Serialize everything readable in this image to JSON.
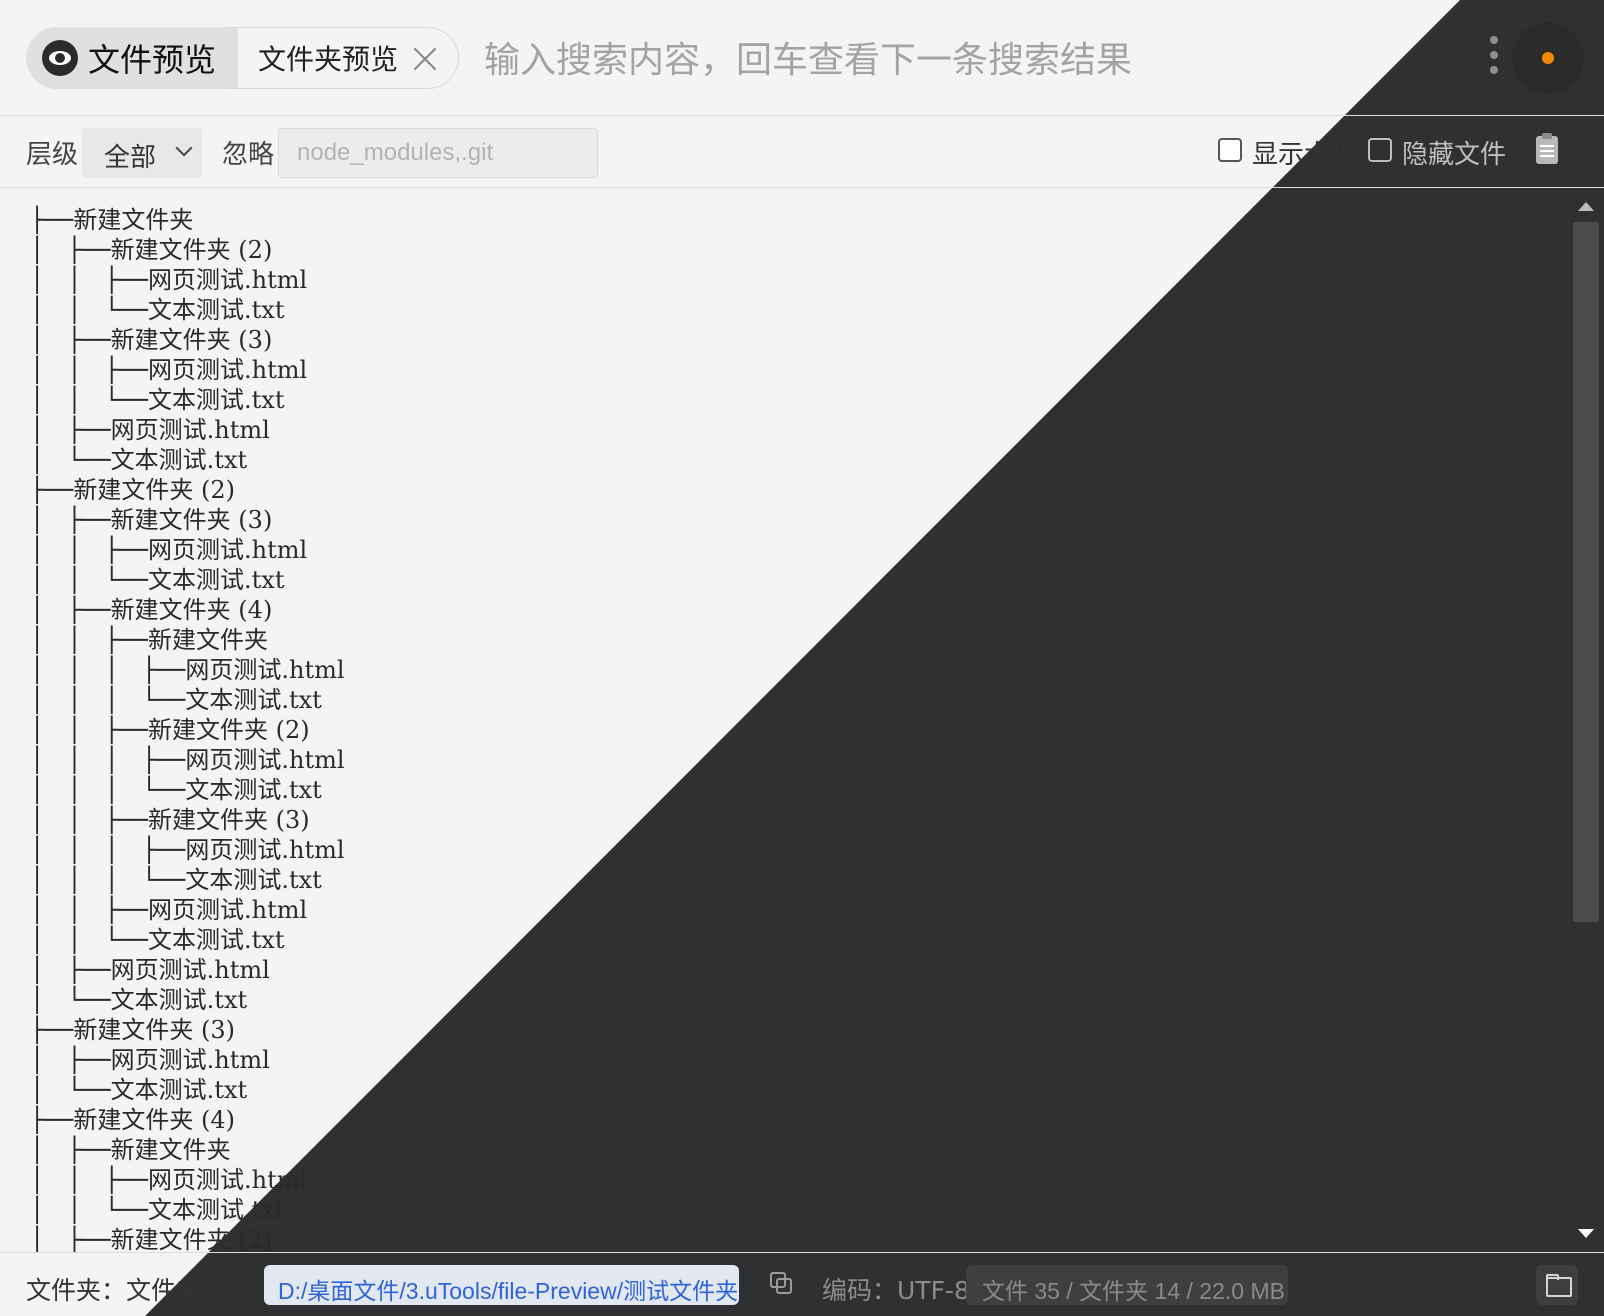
{
  "header": {
    "tabs": [
      {
        "label": "文件预览",
        "active": true,
        "icon": "eye-icon"
      },
      {
        "label": "文件夹预览",
        "active": false
      }
    ],
    "search_placeholder": "输入搜索内容，回车查看下一条搜索结果",
    "accent_color": "#f08a00"
  },
  "toolbar": {
    "level_label": "层级",
    "level_value": "全部",
    "ignore_label": "忽略",
    "ignore_placeholder": "node_modules,.git",
    "show_size_label": "显示大小",
    "hide_files_label": "隐藏文件"
  },
  "tree": [
    "├──新建文件夹",
    "│   ├──新建文件夹 (2)",
    "│   │   ├──网页测试.html",
    "│   │   └──文本测试.txt",
    "│   ├──新建文件夹 (3)",
    "│   │   ├──网页测试.html",
    "│   │   └──文本测试.txt",
    "│   ├──网页测试.html",
    "│   └──文本测试.txt",
    "├──新建文件夹 (2)",
    "│   ├──新建文件夹 (3)",
    "│   │   ├──网页测试.html",
    "│   │   └──文本测试.txt",
    "│   ├──新建文件夹 (4)",
    "│   │   ├──新建文件夹",
    "│   │   │   ├──网页测试.html",
    "│   │   │   └──文本测试.txt",
    "│   │   ├──新建文件夹 (2)",
    "│   │   │   ├──网页测试.html",
    "│   │   │   └──文本测试.txt",
    "│   │   ├──新建文件夹 (3)",
    "│   │   │   ├──网页测试.html",
    "│   │   │   └──文本测试.txt",
    "│   │   ├──网页测试.html",
    "│   │   └──文本测试.txt",
    "│   ├──网页测试.html",
    "│   └──文本测试.txt",
    "├──新建文件夹 (3)",
    "│   ├──网页测试.html",
    "│   └──文本测试.txt",
    "├──新建文件夹 (4)",
    "│   ├──新建文件夹",
    "│   │   ├──网页测试.html",
    "│   │   └──文本测试.txt",
    "│   ├──新建文件夹 (2)"
  ],
  "footer": {
    "folder_label": "文件夹：文件夹测试",
    "path": "D:/桌面文件/3.uTools/file-Preview/测试文件夹",
    "encoding": "编码：UTF-8",
    "stats": "文件 35 / 文件夹 14 / 22.0 MB"
  }
}
